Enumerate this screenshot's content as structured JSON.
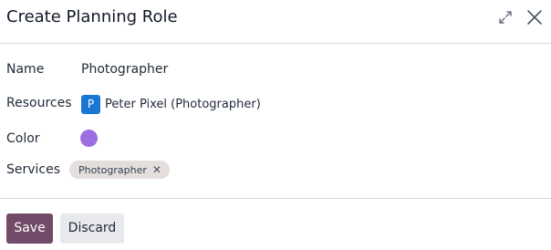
{
  "dialog": {
    "title": "Create Planning Role"
  },
  "fields": {
    "name": {
      "label": "Name",
      "value": "Photographer"
    },
    "resources": {
      "label": "Resources",
      "items": [
        {
          "initial": "P",
          "name": "Peter Pixel (Photographer)",
          "avatar_color": "#1976d2"
        }
      ]
    },
    "color": {
      "label": "Color",
      "value": "#9b6fe0"
    },
    "services": {
      "label": "Services",
      "tags": [
        {
          "label": "Photographer",
          "remove_symbol": "✕"
        }
      ]
    }
  },
  "footer": {
    "save_label": "Save",
    "discard_label": "Discard"
  },
  "colors": {
    "primary": "#714b67",
    "secondary": "#e7e9ed",
    "tag_background": "#e4dfdd"
  },
  "icons": {
    "expand": "expand-icon",
    "close": "close-icon"
  }
}
